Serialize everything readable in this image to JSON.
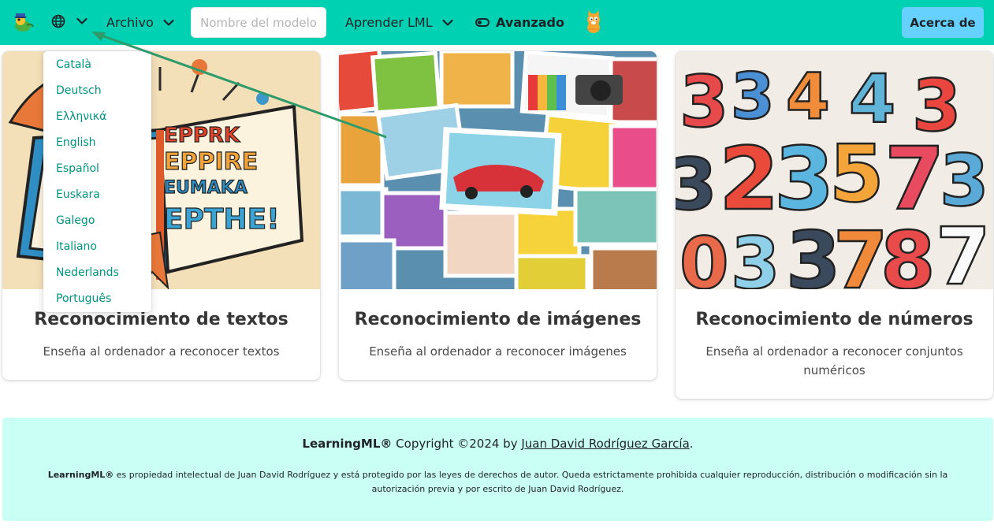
{
  "navbar": {
    "logo_icon": "learningml-logo-icon",
    "globe_icon": "globe-icon",
    "file_menu_label": "Archivo",
    "model_name_placeholder": "Nombre del modelo",
    "model_name_value": "",
    "learn_menu_label": "Aprender LML",
    "advanced_label": "Avanzado",
    "scratch_icon": "scratch-cat-icon",
    "about_label": "Acerca de",
    "accent_color": "#00d1b2",
    "about_button_color": "#66d1ff"
  },
  "language_menu": {
    "items": [
      "Català",
      "Deutsch",
      "Ελληνικά",
      "English",
      "Español",
      "Euskara",
      "Galego",
      "Italiano",
      "Nederlands",
      "Português"
    ],
    "link_color": "#00947e"
  },
  "cards": [
    {
      "title": "Reconocimiento de textos",
      "description": "Enseña al ordenador a reconocer textos",
      "image": "illustrated-book-image"
    },
    {
      "title": "Reconocimiento de imágenes",
      "description": "Enseña al ordenador a reconocer imágenes",
      "image": "photo-collage-image"
    },
    {
      "title": "Reconocimiento de números",
      "description": "Enseña al ordenador a reconocer conjuntos numéricos",
      "image": "colorful-numbers-image"
    }
  ],
  "footer": {
    "brand": "LearningML®",
    "copyright": " Copyright ©2024 by ",
    "author_link": "Juan David Rodríguez García",
    "period": ".",
    "legal_brand": "LearningML®",
    "legal_text": " es propiedad intelectual de Juan David Rodríguez y está protegido por las leyes de derechos de autor. Queda estrictamente prohibida cualquier reproducción, distribución o modificación sin la autorización previa y por escrito de Juan David Rodríguez.",
    "background_color": "#c9fff4"
  },
  "annotation": {
    "arrow_color": "#2f9a6a"
  }
}
